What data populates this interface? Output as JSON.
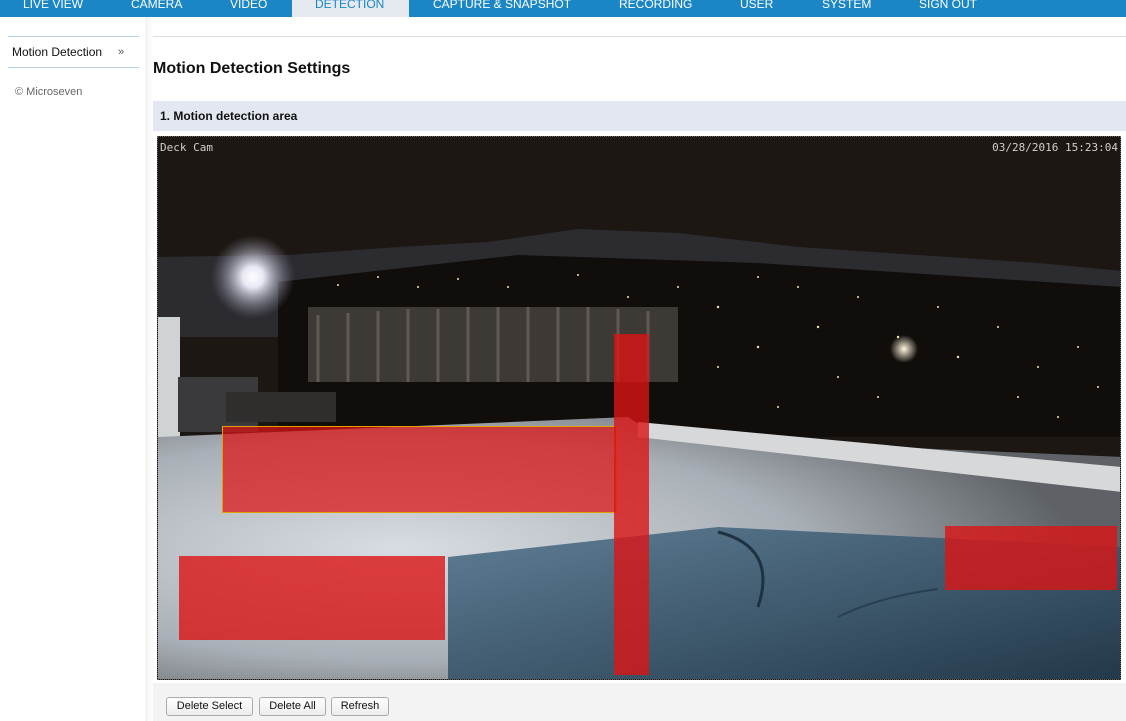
{
  "nav": {
    "tabs": [
      {
        "label": "LIVE VIEW"
      },
      {
        "label": "CAMERA"
      },
      {
        "label": "VIDEO"
      },
      {
        "label": "DETECTION",
        "active": true
      },
      {
        "label": "CAPTURE & SNAPSHOT"
      },
      {
        "label": "RECORDING"
      },
      {
        "label": "USER"
      },
      {
        "label": "SYSTEM"
      },
      {
        "label": "SIGN OUT"
      }
    ]
  },
  "sidebar": {
    "items": [
      {
        "label": "Motion Detection",
        "arrow": "»"
      }
    ],
    "copyright": "© Microseven"
  },
  "main": {
    "title": "Motion Detection Settings",
    "section_title": "1. Motion detection area",
    "video": {
      "camera_name": "Deck Cam",
      "timestamp": "03/28/2016 15:23:04",
      "zone_color": "#dc1414",
      "zone_count": 5
    },
    "buttons": {
      "delete_select": "Delete Select",
      "delete_all": "Delete All",
      "refresh": "Refresh"
    }
  },
  "colors": {
    "nav_bg": "#1b86c6",
    "active_tab_bg": "#e4eaf0",
    "section_bg": "#e2e7f0"
  }
}
